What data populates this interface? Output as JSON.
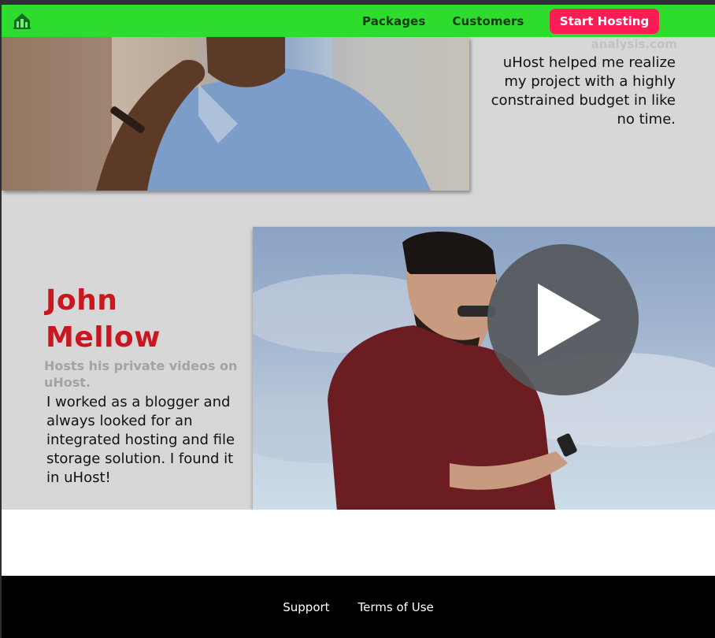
{
  "header": {
    "nav_items": [
      "Packages",
      "Customers"
    ],
    "cta_label": "Start Hosting"
  },
  "customer_top": {
    "site": "analysis.com",
    "quote": "uHost helped me realize my project with a highly constrained budget in like no time."
  },
  "customer_bottom": {
    "name": "John Mellow",
    "subtitle": "Hosts his private videos on uHost.",
    "quote": "I worked as a blogger and always looked for an integrated hosting and file storage solution. I found it in uHost!"
  },
  "footer": {
    "links": [
      "Support",
      "Terms of Use"
    ]
  },
  "colors": {
    "header_bg": "#2ddc2d",
    "cta_bg": "#ff1b54",
    "name_color": "#c9161f",
    "footer_bg": "#000000"
  },
  "icons": {
    "logo": "uhost-logo-icon",
    "play": "play-icon"
  }
}
